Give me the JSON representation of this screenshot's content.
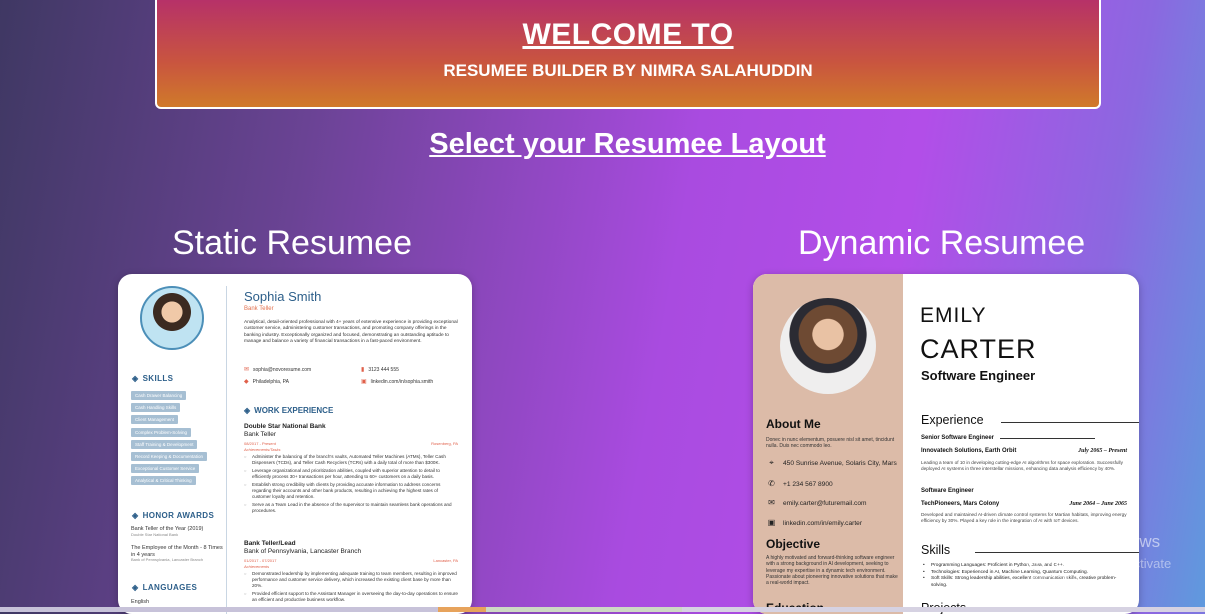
{
  "banner": {
    "title": "WELCOME TO",
    "subtitle": "RESUMEE BUILDER BY NIMRA SALAHUDDIN"
  },
  "select_title": "Select your Resumee Layout",
  "options": {
    "static_label": "Static Resumee",
    "dynamic_label": "Dynamic Resumee"
  },
  "static_resume": {
    "name": "Sophia Smith",
    "role": "Bank Teller",
    "summary": "Analytical, detail-oriented professional with 4+ years of extensive experience in providing exceptional customer service, administering customer transactions, and promoting company offerings in the banking industry. Exceptionally organized and focused, demonstrating an outstanding aptitude to manage and balance a variety of financial transactions in a fast-paced environment.",
    "email": "sophia@novoresume.com",
    "phone": "3123 444 555",
    "location": "Philadelphia, PA",
    "linkedin": "linkedin.com/in/sophia.smith",
    "skills_heading": "SKILLS",
    "skills": [
      "Cash Drawer Balancing",
      "Cash Handling Skills",
      "Client Management",
      "Complex Problem-Solving",
      "Staff Training & Development",
      "Record Keeping & Documentation",
      "Exceptional Customer Service",
      "Analytical & Critical Thinking"
    ],
    "honor_heading": "HONOR AWARDS",
    "honor1_title": "Bank Teller of the Year (2019)",
    "honor1_sub": "Double Star National Bank",
    "honor2_title": "The Employee of the Month - 8 Times in 4 years",
    "honor2_sub": "Bank of Pennsylvania, Lancaster Branch",
    "languages_heading": "LANGUAGES",
    "language1": "English",
    "work_heading": "WORK EXPERIENCE",
    "job1_company": "Double Star National Bank",
    "job1_role": "Bank Teller",
    "job1_dates": "08/2017 - Present",
    "job1_location": "Rosenberg, PA",
    "job1_achievements": "Achievements/Tasks",
    "job1_bullets": [
      "Administer the balancing of the branch's vaults, Automated Teller Machines (ATMs), Teller Cash Dispensers (TCDs), and Teller Cash Recyclers (TCRs) with a daily total of more than $300K.",
      "Leverage organizational and prioritization abilities, coupled with superior attention to detail to efficiently process 30+ transactions per hour, attending to 60+ customers on a daily basis.",
      "Establish strong credibility with clients by providing accurate information to address concerns regarding their accounts and other bank products, resulting in achieving the highest rates of customer loyalty and retention.",
      "Serve as a Team Lead in the absence of the supervisor to maintain seamless bank operations and procedures."
    ],
    "job2_role": "Bank Teller/Lead",
    "job2_company": "Bank of Pennsylvania, Lancaster Branch",
    "job2_dates": "01/2017 - 07/2017",
    "job2_location": "Lancaster, PA",
    "job2_achievements": "Achievements",
    "job2_bullets": [
      "Demonstrated leadership by implementing adequate training to team members, resulting in improved performance and customer service delivery, which increased the existing client base by more than 20%.",
      "Provided efficient support to the Assistant Manager in overseeing the day-to-day operations to ensure an efficient and productive business workflow."
    ]
  },
  "dynamic_resume": {
    "first_name": "EMILY",
    "last_name": "CARTER",
    "title": "Software Engineer",
    "about_heading": "About Me",
    "about_text": "Donec in nunc elementum, posuere nisl sit amet, tincidunt nulla. Duis nec commodo leo.",
    "address": "450 Sunrise Avenue, Solaris City, Mars",
    "phone": "+1 234 567 8900",
    "email": "emily.carter@futuremail.com",
    "linkedin": "linkedin.com/in/emily.carter",
    "objective_heading": "Objective",
    "objective_text": "A highly motivated and forward-thinking software engineer with a strong background in AI development, seeking to leverage my expertise in a dynamic tech environment. Passionate about pioneering innovative solutions that make a real-world impact.",
    "education_heading": "Education",
    "experience_heading": "Experience",
    "job1_title": "Senior Software Engineer",
    "job1_company": "Innovatech Solutions, Earth Orbit",
    "job1_dates": "July 2065 – Present",
    "job1_desc": "Leading a team of 10 in developing cutting-edge AI algorithms for space exploration. Successfully deployed AI systems in three interstellar missions, enhancing data analysis efficiency by 40%.",
    "job2_title": "Software Engineer",
    "job2_company": "TechPioneers, Mars Colony",
    "job2_dates": "June 2064 – June 2065",
    "job2_desc": "Developed and maintained AI-driven climate control systems for Martian habitats, improving energy efficiency by 30%. Played a key role in the integration of AI with IoT devices.",
    "skills_heading": "Skills",
    "skills": [
      "Programming Languages: Proficient in Python, Java, and C++.",
      "Technologies: Experienced in AI, Machine Learning, Quantum Computing.",
      "Soft Skills: Strong leadership abilities, excellent communication skills, creative problem-solving."
    ],
    "projects_heading": "Projects"
  },
  "watermark": {
    "line1": "Activate Windows",
    "line2": "Go to Settings to activate Windows."
  },
  "colors": {
    "accent_static": "#2d5f8a",
    "accent_static_secondary": "#e0604a",
    "dynamic_sidebar": "#dcbba8",
    "banner_top": "#b52f6b",
    "banner_bottom": "#d07a2a"
  }
}
